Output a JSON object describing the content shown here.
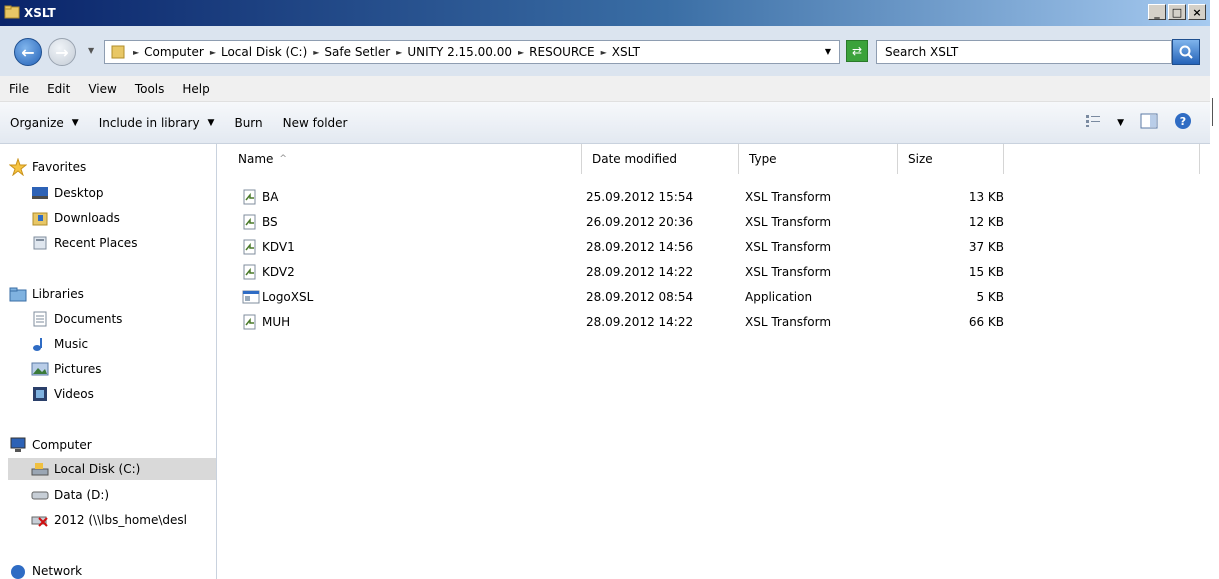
{
  "window": {
    "title": "XSLT",
    "minimize": "_",
    "maximize": "□",
    "close": "×"
  },
  "address": {
    "breadcrumbs": [
      "Computer",
      "Local Disk (C:)",
      "Safe Setler",
      "UNITY 2.15.00.00",
      "RESOURCE",
      "XSLT"
    ],
    "search_placeholder": "Search XSLT"
  },
  "menu": {
    "items": [
      "File",
      "Edit",
      "View",
      "Tools",
      "Help"
    ]
  },
  "commands": {
    "organize": "Organize",
    "include": "Include in library",
    "burn": "Burn",
    "new_folder": "New folder"
  },
  "nav": {
    "favorites": "Favorites",
    "desktop": "Desktop",
    "downloads": "Downloads",
    "recent": "Recent Places",
    "libraries": "Libraries",
    "documents": "Documents",
    "music": "Music",
    "pictures": "Pictures",
    "videos": "Videos",
    "computer": "Computer",
    "local_disk": "Local Disk (C:)",
    "data_disk": "Data (D:)",
    "network_drive": "2012 (\\\\lbs_home\\desl",
    "network": "Network"
  },
  "columns": {
    "name": "Name",
    "date": "Date modified",
    "type": "Type",
    "size": "Size",
    "sort_indicator": "^"
  },
  "files": [
    {
      "name": "BA",
      "date": "25.09.2012 15:54",
      "type": "XSL Transform",
      "size": "13 KB",
      "icon": "xsl-file-icon"
    },
    {
      "name": "BS",
      "date": "26.09.2012 20:36",
      "type": "XSL Transform",
      "size": "12 KB",
      "icon": "xsl-file-icon"
    },
    {
      "name": "KDV1",
      "date": "28.09.2012 14:56",
      "type": "XSL Transform",
      "size": "37 KB",
      "icon": "xsl-file-icon"
    },
    {
      "name": "KDV2",
      "date": "28.09.2012 14:22",
      "type": "XSL Transform",
      "size": "15 KB",
      "icon": "xsl-file-icon"
    },
    {
      "name": "LogoXSL",
      "date": "28.09.2012 08:54",
      "type": "Application",
      "size": "5 KB",
      "icon": "application-icon"
    },
    {
      "name": "MUH",
      "date": "28.09.2012 14:22",
      "type": "XSL Transform",
      "size": "66 KB",
      "icon": "xsl-file-icon"
    }
  ],
  "colors": {
    "titlebar": "#0a246a",
    "selection": "#d9d9d9",
    "accent": "#2563b8"
  }
}
